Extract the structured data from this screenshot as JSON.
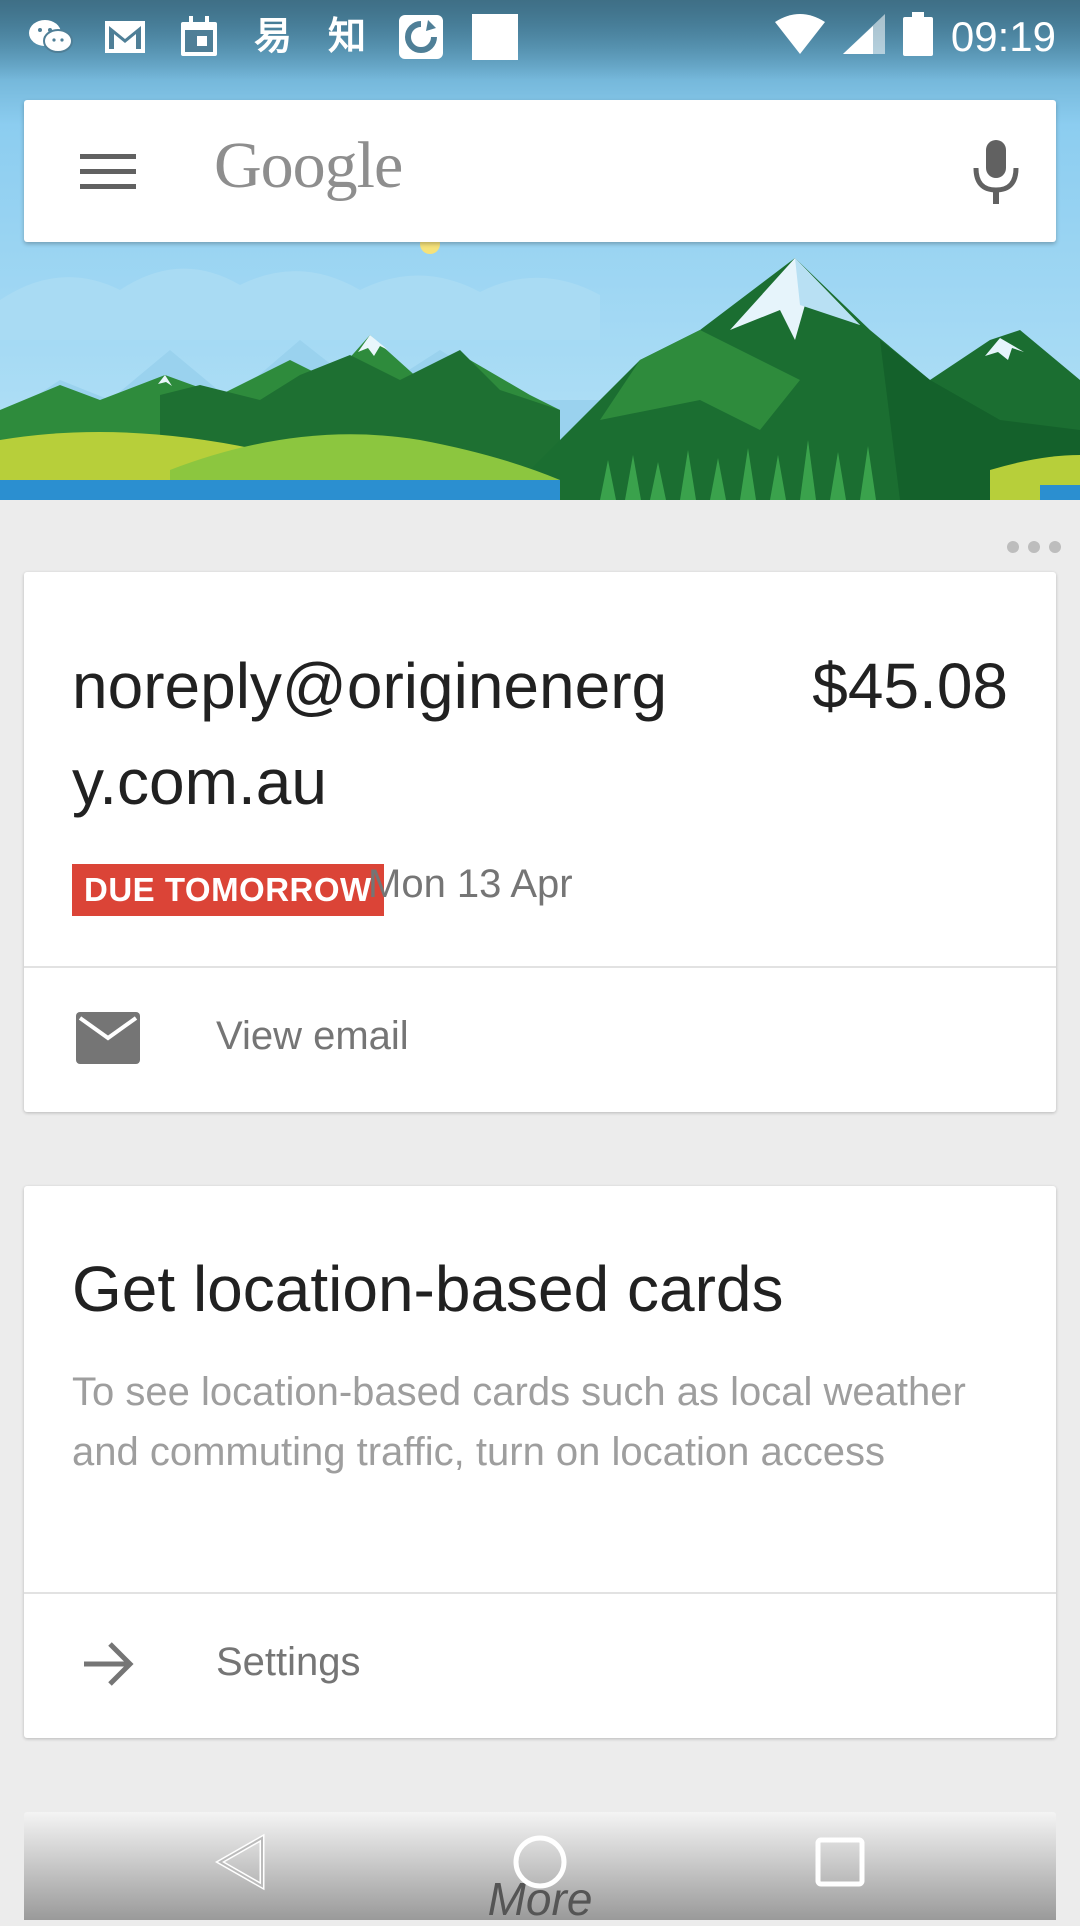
{
  "status_bar": {
    "left_icons": [
      "wechat-icon",
      "gmail-icon",
      "calendar-icon",
      "yi-app-icon",
      "zhihu-app-icon",
      "sync-icon",
      "blank-notification-icon"
    ],
    "yi_glyph": "易",
    "zhi_glyph": "知",
    "right_icons": [
      "wifi-icon",
      "signal-icon",
      "battery-icon"
    ],
    "time": "09:19"
  },
  "search": {
    "logo_text": "Google",
    "menu_icon": "hamburger-menu-icon",
    "voice_icon": "microphone-icon"
  },
  "bill_card": {
    "sender": "noreply@originenergy.com.au",
    "amount": "$45.08",
    "badge": "DUE TOMORROW",
    "date": "Mon 13 Apr",
    "action_icon": "email-icon",
    "action_label": "View email"
  },
  "location_card": {
    "title": "Get location-based cards",
    "body": "To see location-based cards such as local weather and commuting traffic, turn on location access",
    "action_icon": "arrow-right-icon",
    "action_label": "Settings"
  },
  "bottom": {
    "more_label": "More"
  },
  "colors": {
    "badge_red": "#db4437",
    "sky": "#8fd1f3",
    "background": "#ececec"
  }
}
